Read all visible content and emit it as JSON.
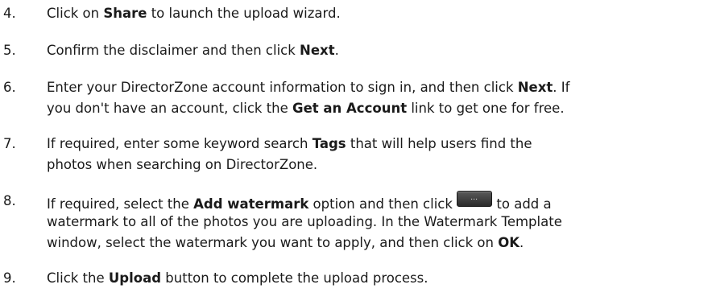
{
  "steps": [
    {
      "number": "4.",
      "lines": [
        [
          "Click on ",
          {
            "b": "Share"
          },
          " to launch the upload wizard."
        ]
      ]
    },
    {
      "number": "5.",
      "lines": [
        [
          "Confirm the disclaimer and then click ",
          {
            "b": "Next"
          },
          "."
        ]
      ]
    },
    {
      "number": "6.",
      "lines": [
        [
          "Enter your DirectorZone account information to sign in, and then click ",
          {
            "b": "Next"
          },
          ". If"
        ],
        [
          "you don't have an account, click the ",
          {
            "b": "Get an Account"
          },
          " link to get one for free."
        ]
      ]
    },
    {
      "number": "7.",
      "lines": [
        [
          "If required, enter some keyword search ",
          {
            "b": "Tags"
          },
          " that will help users find the"
        ],
        [
          "photos when searching on DirectorZone."
        ]
      ]
    },
    {
      "number": "8.",
      "lines": [
        [
          "If required, select the ",
          {
            "b": "Add watermark"
          },
          " option and then click ",
          {
            "icon": "ellipsis-button-icon",
            "glyph": "…"
          },
          " to add a"
        ],
        [
          "watermark to all of the photos you are uploading. In the Watermark Template"
        ],
        [
          "window, select the watermark you want to apply, and then click on ",
          {
            "b": "OK"
          },
          "."
        ]
      ]
    },
    {
      "number": "9.",
      "lines": [
        [
          "Click the ",
          {
            "b": "Upload"
          },
          " button to complete the upload process."
        ]
      ]
    }
  ]
}
